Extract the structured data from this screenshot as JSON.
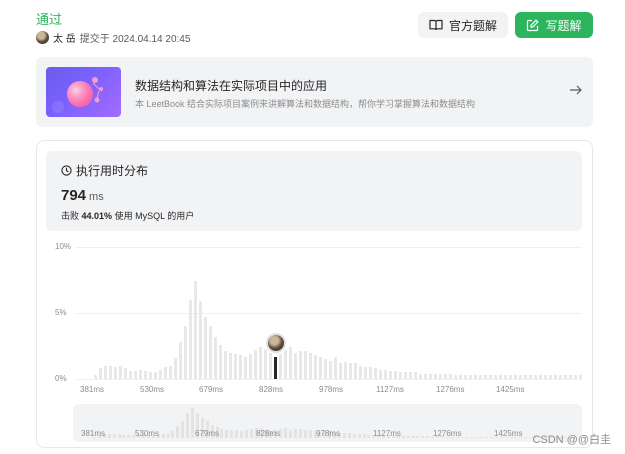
{
  "result": {
    "status": "通过",
    "submitter_name": "太 岳",
    "submitted_text": "提交于 2024.04.14 20:45"
  },
  "actions": {
    "official_solution": "官方题解",
    "write_solution": "写题解"
  },
  "leetbook": {
    "title": "数据结构和算法在实际项目中的应用",
    "description": "本 LeetBook 结合实际项目案例来讲解算法和数据结构，帮你学习掌握算法和数据结构"
  },
  "runtime": {
    "heading": "执行用时分布",
    "value": "794",
    "unit": "ms",
    "beat_prefix": "击败",
    "beat_percent": "44.01%",
    "beat_suffix": "使用 MySQL 的用户"
  },
  "chart_data": {
    "type": "bar",
    "ylabel_ticks": [
      "10%",
      "5%",
      "0%"
    ],
    "ylim": [
      0,
      10
    ],
    "x_tick_labels": [
      "381ms",
      "530ms",
      "679ms",
      "828ms",
      "978ms",
      "1127ms",
      "1276ms",
      "1425ms"
    ],
    "current_index": 36,
    "values": [
      0.3,
      0.8,
      1.0,
      1.0,
      0.9,
      1.0,
      0.8,
      0.6,
      0.6,
      0.7,
      0.6,
      0.5,
      0.5,
      0.7,
      0.9,
      1.0,
      1.6,
      2.8,
      4.0,
      6.0,
      7.4,
      5.9,
      4.7,
      4.0,
      3.2,
      2.6,
      2.1,
      2.0,
      1.9,
      1.8,
      1.7,
      1.9,
      2.2,
      2.4,
      2.3,
      2.0,
      1.7,
      1.9,
      2.2,
      2.4,
      2.0,
      2.1,
      2.1,
      2.0,
      1.8,
      1.7,
      1.5,
      1.4,
      1.7,
      1.2,
      1.3,
      1.2,
      1.2,
      1.0,
      0.9,
      0.9,
      0.8,
      0.7,
      0.7,
      0.6,
      0.6,
      0.5,
      0.5,
      0.5,
      0.5,
      0.4,
      0.4,
      0.4,
      0.4,
      0.4,
      0.4,
      0.4,
      0.3,
      0.3,
      0.3,
      0.3,
      0.3,
      0.3,
      0.3,
      0.3,
      0.3,
      0.3,
      0.3,
      0.3,
      0.3,
      0.3,
      0.3,
      0.3,
      0.3,
      0.3,
      0.3,
      0.3,
      0.3,
      0.3,
      0.3,
      0.3,
      0.3,
      0.3
    ],
    "color_bar": "#e8e8e8",
    "color_current": "#262626"
  },
  "minimap": {
    "x_tick_labels": [
      "381ms",
      "530ms",
      "679ms",
      "828ms",
      "978ms",
      "1127ms",
      "1276ms",
      "1425ms"
    ]
  },
  "watermark": "CSDN @@白圭",
  "colors": {
    "accent_green": "#2db55d",
    "panel_gray": "#f2f3f5"
  }
}
